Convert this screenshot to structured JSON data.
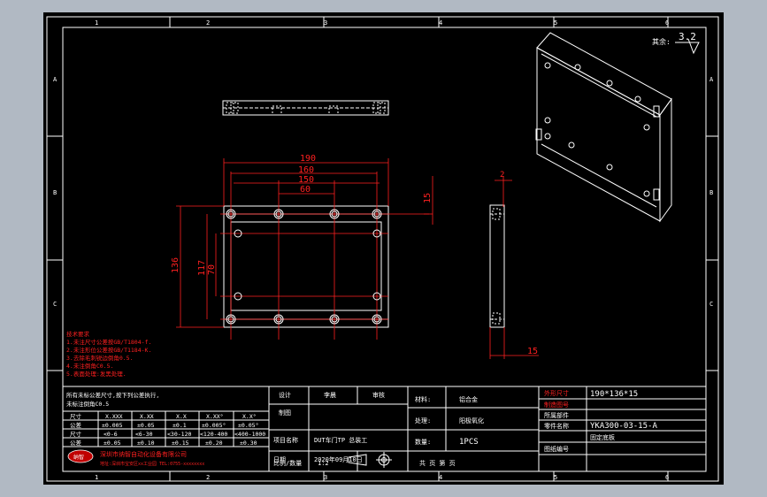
{
  "colors": {
    "background": "#000000",
    "frame": "#ffffff",
    "dimension": "#ff2020",
    "centerline": "#ff2020",
    "annotation": "#ff2020"
  },
  "border_zones": {
    "top": [
      "1",
      "2",
      "3",
      "4",
      "5",
      "6"
    ],
    "bottom": [
      "1",
      "2",
      "3",
      "4",
      "5",
      "6"
    ],
    "left": [
      "A",
      "B",
      "C"
    ],
    "right": [
      "A",
      "B",
      "C"
    ]
  },
  "surface_finish": {
    "label": "其余:",
    "value": "3.2"
  },
  "dimensions": {
    "top_view_width": "190",
    "hole_span_outer": "160",
    "hole_span_inner": "150",
    "hole_span_center": "60",
    "height": "136",
    "hole_height_outer": "117",
    "hole_height_inner": "70",
    "thickness_side": "15",
    "right_view_top": "2",
    "right_view_thickness": "15"
  },
  "tech_notes": {
    "title": "技术要求",
    "lines": [
      "1.未注尺寸公差按GB/T1804-f.",
      "2.未注形位公差按GB/T1184-K.",
      "3.去除毛刺锐边倒角0.5.",
      "4.未注倒角C0.5.",
      "5.表面处理:发黑处理."
    ]
  },
  "tolerance_table": {
    "header_note": [
      "所有未标公差尺寸,按下列公差执行,",
      "未标注倒角C0.5"
    ],
    "columns": [
      "尺寸",
      "X.XXX",
      "X.XX",
      "X.X",
      "X.XX°",
      "X.X°"
    ],
    "rows": [
      [
        "公差",
        "±0.005",
        "±0.05",
        "±0.1",
        "±0.005°",
        "±0.05°"
      ],
      [
        "尺寸",
        "<0-6",
        "<6-30",
        "<30-120",
        "<120-400",
        "<400-1000"
      ],
      [
        "公差",
        "±0.05",
        "±0.10",
        "±0.15",
        "±0.20",
        "±0.30"
      ]
    ]
  },
  "company": {
    "logo": "纳智",
    "name": "深圳市纳智自动化设备有限公司",
    "address": "地址:深圳市宝安区xx工业园 TEL:0755-xxxxxxxx"
  },
  "title_block": {
    "designer_label": "设计",
    "designer": "李晨",
    "checker_label": "审核",
    "drawer_label": "制图",
    "project_label": "项目名称",
    "project": "DUT车门TP 总装工",
    "date_label": "日期",
    "date": "2020年09月10日",
    "scale_label": "比例/数量",
    "scale": "1:2",
    "material_label": "材料:",
    "material": "铝合金",
    "finish_label": "处理:",
    "finish": "阳极氧化",
    "qty_label": "数量:",
    "qty": "1PCS",
    "sheet_label": "共 页 第 页",
    "size_label": "外形尺寸",
    "size": "190*136*15",
    "part_no_label": "制造图号",
    "part_no": "YKA300-03-15-A",
    "part_name_label": "零件名称",
    "part_name": "固定底板",
    "assembly_label": "所属部件",
    "assembly": "",
    "drawing_no_label": "图纸编号",
    "drawing_no": ""
  }
}
